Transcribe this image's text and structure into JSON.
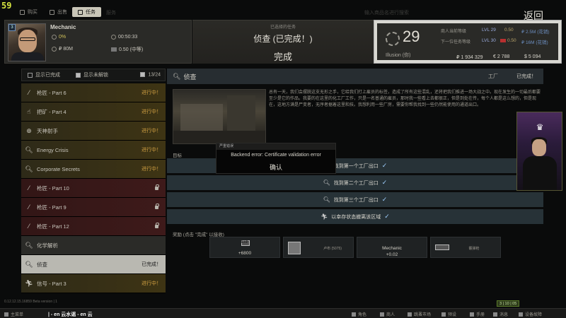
{
  "fps": "59",
  "topbar": {
    "tabs": [
      {
        "label": "购买",
        "active": false
      },
      {
        "label": "出售",
        "active": false
      },
      {
        "label": "任务",
        "active": true
      }
    ],
    "faint_label": "服务",
    "faint_right": "输入商品名进行搜索",
    "back_label": "返回"
  },
  "trader": {
    "name": "Mechanic",
    "level_badge": "3",
    "standing": "0%",
    "timer": "00:50:33",
    "spent": "₽ 80M",
    "rep": "0.50 (中等)"
  },
  "quest_header": {
    "sub": "已选择的任务",
    "title": "侦查 (已完成！)",
    "status": "完成"
  },
  "player": {
    "level": "29",
    "name": "Illusion (你)",
    "row1_label": "商人当前等级",
    "row2_label": "下一位任务等级",
    "row1_lvl": "LVL 29",
    "row1_rep": "0.50",
    "row1_sales": "₽ 2.5M (花销)",
    "row2_lvl": "LVL 30",
    "row2_rep": "0.50",
    "row2_sales": "₽ 16M (花销)",
    "rubles": "₽ 1 934 329",
    "euros": "€ 2 788",
    "dollars": "$ 5 094"
  },
  "filter": {
    "show_completed": "显示已完成",
    "show_locked": "显示未解锁",
    "count": "13/24"
  },
  "quests": [
    {
      "icon": "rifle-icon",
      "label": "枪匠 - Part 6",
      "status": "进行中！",
      "kind": "prog"
    },
    {
      "icon": "hand-icon",
      "label": "把矿 - Part 4",
      "status": "进行中！",
      "kind": "prog"
    },
    {
      "icon": "crosshair-icon",
      "label": "天神射手",
      "status": "进行中！",
      "kind": "prog"
    },
    {
      "icon": "search-icon",
      "label": "Energy Crisis",
      "status": "进行中！",
      "kind": "prog"
    },
    {
      "icon": "search-icon",
      "label": "Corporate Secrets",
      "status": "进行中！",
      "kind": "prog"
    },
    {
      "icon": "rifle-icon",
      "label": "枪匠 - Part 10",
      "status": "",
      "kind": "lock"
    },
    {
      "icon": "rifle-icon",
      "label": "枪匠 - Part 9",
      "status": "",
      "kind": "lock"
    },
    {
      "icon": "rifle-icon",
      "label": "枪匠 - Part 12",
      "status": "",
      "kind": "lock"
    },
    {
      "icon": "search-icon",
      "label": "化学解析",
      "status": "",
      "kind": "plain"
    },
    {
      "icon": "search-icon",
      "label": "侦查",
      "status": "已完成！",
      "kind": "done"
    },
    {
      "icon": "runner-icon",
      "label": "信号 - Part 3",
      "status": "进行中！",
      "kind": "prog"
    }
  ],
  "detail": {
    "title": "侦查",
    "location": "工厂",
    "status": "已完成！",
    "description": "总有一天，我们会摆脱这支无形之手，它给我们打上雇员的标签，造成了所有这些混乱，还将把我们推进一场大战之中。现在发生的一切最后都要至少是它的作品。我要的在这里的化工厂工作，只是一名普通的雇员，那时我一些看上去都很正，但是到处在传，每个人都是这么想的，但是现在，这地方满是尸变者，无序者据着这里和技。我想利用一些厂房，需要你帮我找到一些仍然能使用的通道出口。",
    "objectives_label": "目标",
    "objectives": [
      {
        "icon": "search-icon",
        "label": "找到第一个工厂出口"
      },
      {
        "icon": "search-icon",
        "label": "找到第二个工厂出口"
      },
      {
        "icon": "search-icon",
        "label": "找到第三个工厂出口"
      },
      {
        "icon": "runner-icon",
        "label": "以幸存状态撤离该区域"
      }
    ],
    "rewards_label": "奖励 (点击 \"完成\" 以接收)",
    "rewards": [
      {
        "icon": "exp-icon",
        "line1": "EXP",
        "line2": "+6800"
      },
      {
        "icon": "item-icon",
        "line1": "卢布 (5075)",
        "line2": ""
      },
      {
        "icon": "rep-icon",
        "line1": "Mechanic",
        "line2": "+0.02"
      },
      {
        "icon": "weapon-icon",
        "line1": "霰弹枪",
        "line2": ""
      }
    ]
  },
  "modal": {
    "header": "严重错误",
    "message": "Backend error: Certificate validation error",
    "ok_label": "确认"
  },
  "version": "0.12.12.15.16859 Beta version | 1",
  "overlay_name": "| - en 云水谣 - en 云",
  "bottombar": {
    "items": [
      "主菜单",
      "角色",
      "商人",
      "跳蚤市场",
      "预设",
      "手册",
      "消息",
      "设备故障"
    ]
  },
  "green_box": "3 | 10 | 05"
}
